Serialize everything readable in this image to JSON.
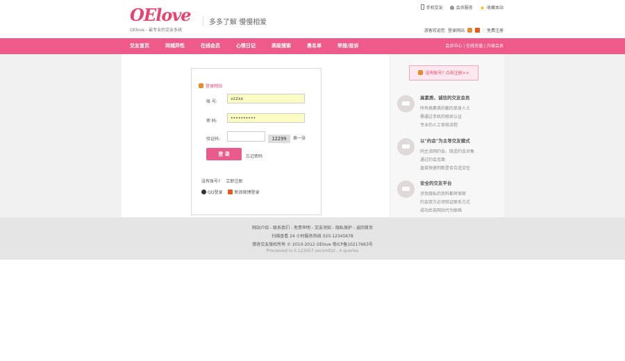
{
  "header": {
    "logo_text": "OElove",
    "logo_sub": "OElove - 最专业的交友系统",
    "slogan": "多多了解  慢慢相爱",
    "top_links": [
      "手机交友",
      "会员服务",
      "收藏本站"
    ],
    "login_links": [
      "游客欢迎您",
      "登录网站",
      "免费注册"
    ]
  },
  "nav": {
    "items": [
      "交友首页",
      "同城异性",
      "在线会员",
      "心情日记",
      "高级搜索",
      "黑名单",
      "举报/投诉"
    ],
    "right": "会员中心 | 在线充值 | 升级会员"
  },
  "login": {
    "title": "登录网站",
    "account_label": "账  号:",
    "account_value": "vzzxx",
    "password_label": "密  码:",
    "password_value": "••••••••••",
    "captcha_label": "验证码:",
    "captcha_value": "12299",
    "refresh": "换一张",
    "submit": "登 录",
    "forgot": "忘记密码",
    "no_account": "没有账号?",
    "register_now": "立即注册",
    "qq_login": "QQ登录",
    "weibo_login": "新浪微博登录"
  },
  "sidebar": {
    "register_button": "没有账号? 点击注册>>",
    "features": [
      {
        "title": "高素质、诚信的交友会员",
        "lines": [
          "所有高素质的都的单身人士",
          "需通过手机的相关认证",
          "专业的人工审核流程"
        ]
      },
      {
        "title": "以\"约会\"为主导交友模式",
        "lines": [
          "同主流网约会、既适约会对象",
          "通过约会见面",
          "直接快速判断是否合适交往"
        ]
      },
      {
        "title": "安全的交友平台",
        "lines": [
          "涉及隐私的资料都将保密",
          "约会双方必须验证联系方式",
          "成功后自网站代为联络"
        ]
      }
    ]
  },
  "footer": {
    "links": "网站介绍 - 联系我们 - 免责申明 - 交友须知 - 隐私保护 - 返回首页",
    "hotline": "扫描查看      24 小时服务热线 020-12345678",
    "copyright": "猎奇交友版权所有 © 2010-2012 OElove   粤ICP备10217663号",
    "processed": "Processed in 0.123057 second(s) , 4 queries"
  }
}
